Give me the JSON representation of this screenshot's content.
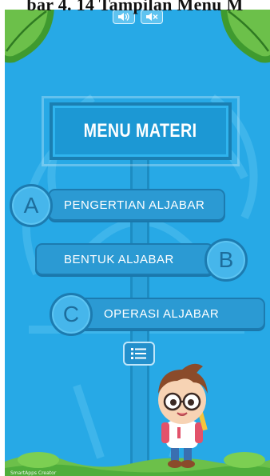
{
  "caption": {
    "text": "bar 4. 14 Tampilan Menu M"
  },
  "sound": {
    "on_icon": "speaker-on-icon",
    "off_icon": "speaker-mute-icon"
  },
  "sign": {
    "title": "MENU MATERI"
  },
  "menu": {
    "items": [
      {
        "letter": "A",
        "label": "PENGERTIAN ALJABAR"
      },
      {
        "letter": "B",
        "label": "BENTUK ALJABAR"
      },
      {
        "letter": "C",
        "label": "OPERASI ALJABAR"
      }
    ]
  },
  "list_button": {
    "icon": "list-icon"
  },
  "footer": {
    "credit": "SmartApps Creator"
  },
  "colors": {
    "background": "#27a9e6",
    "button": "#2b9ad3",
    "button_border": "#1c7bb0",
    "leaf": "#4fae3b",
    "grass": "#6cc04a",
    "text": "#ffffff"
  }
}
